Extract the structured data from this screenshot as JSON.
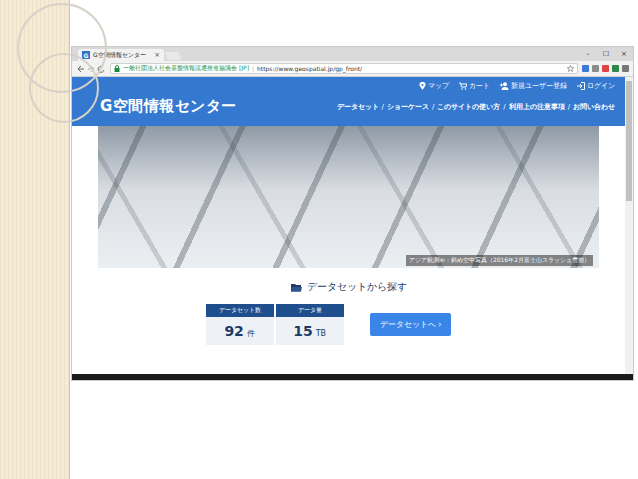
{
  "browser": {
    "tab_favicon": "G",
    "tab_title": "G空間情報センター",
    "tab_close": "×",
    "window_controls": [
      "–",
      "☐",
      "×"
    ],
    "site_identity": "一般社団法人社会基盤情報流通推進協議会 [JP]",
    "url": "https://www.geospatial.jp/gp_front/"
  },
  "top_links": [
    "マップ",
    "カート",
    "新規ユーザー登録",
    "ログイン"
  ],
  "logo": "G空間情報センター",
  "nav": {
    "separator": "/",
    "items": [
      "データセット",
      "ショーケース",
      "このサイトの使い方",
      "利用上の注意事項",
      "お問い合わせ"
    ]
  },
  "hero": {
    "caption": "アジア航測㈱：斜め空中写真（2016年2月富士山スラッシュ雪崩）"
  },
  "section_title": "データセットから探す",
  "stats": [
    {
      "label": "データセット数",
      "value": "92",
      "unit": "件"
    },
    {
      "label": "データ量",
      "value": "15",
      "unit": "TB"
    }
  ],
  "button": "データセットへ ›"
}
